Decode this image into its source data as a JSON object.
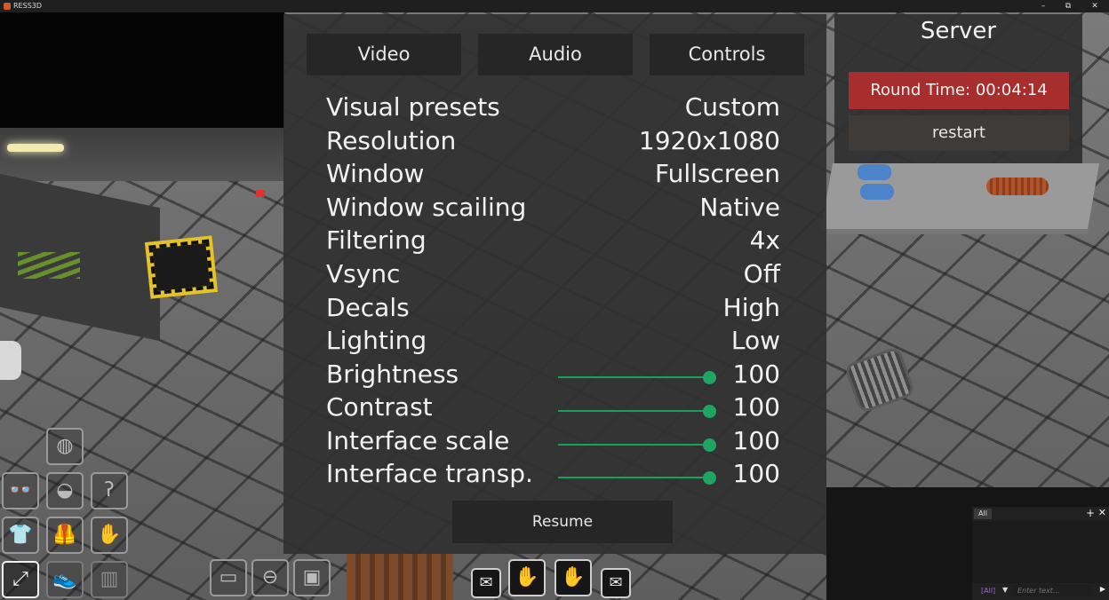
{
  "window": {
    "title": "RESS3D",
    "minimize": "–",
    "restore": "⧉",
    "close": "✕"
  },
  "settings": {
    "tabs": [
      {
        "label": "Video"
      },
      {
        "label": "Audio"
      },
      {
        "label": "Controls"
      }
    ],
    "rows": [
      {
        "label": "Visual presets",
        "value": "Custom"
      },
      {
        "label": "Resolution",
        "value": "1920x1080"
      },
      {
        "label": "Window",
        "value": "Fullscreen"
      },
      {
        "label": "Window scailing",
        "value": "Native"
      },
      {
        "label": "Filtering",
        "value": "4x"
      },
      {
        "label": "Vsync",
        "value": "Off"
      },
      {
        "label": "Decals",
        "value": "High"
      },
      {
        "label": "Lighting",
        "value": "Low"
      }
    ],
    "sliders": [
      {
        "label": "Brightness",
        "value": "100",
        "level": 1.0
      },
      {
        "label": "Contrast",
        "value": "100",
        "level": 1.0
      },
      {
        "label": "Interface scale",
        "value": "100",
        "level": 1.0
      },
      {
        "label": "Interface transp.",
        "value": "100",
        "level": 1.0
      }
    ],
    "resume_label": "Resume",
    "slider_color": "#1ea55f"
  },
  "server": {
    "title": "Server",
    "round_time": "Round Time: 00:04:14",
    "restart_label": "restart",
    "round_time_color": "#a82e2e"
  },
  "inventory": {
    "slots": [
      {
        "name": "helmet-slot",
        "icon": "helmet-icon",
        "glyph": "◍"
      },
      {
        "name": "glasses-slot",
        "icon": "glasses-icon",
        "glyph": "👓"
      },
      {
        "name": "mask-slot",
        "icon": "mask-icon",
        "glyph": "◒"
      },
      {
        "name": "ear-slot",
        "icon": "ear-icon",
        "glyph": "ʔ"
      },
      {
        "name": "uniform-slot",
        "icon": "shirt-icon",
        "glyph": "👕"
      },
      {
        "name": "vest-slot",
        "icon": "vest-icon",
        "glyph": "🦺"
      },
      {
        "name": "gloves-slot",
        "icon": "glove-icon",
        "glyph": "✋"
      },
      {
        "name": "toggle-inventory-slot",
        "icon": "expand-icon",
        "glyph": "⤢"
      },
      {
        "name": "shoes-slot",
        "icon": "shoes-icon",
        "glyph": "👟"
      },
      {
        "name": "suit-slot",
        "icon": "suit-icon",
        "glyph": "▥"
      },
      {
        "name": "id-card-slot",
        "icon": "id-card-icon",
        "glyph": "▭"
      },
      {
        "name": "belt-slot",
        "icon": "belt-icon",
        "glyph": "⊖"
      },
      {
        "name": "backpack-slot",
        "icon": "backpack-icon",
        "glyph": "▣"
      },
      {
        "name": "left-pocket-slot",
        "icon": "pocket-icon",
        "glyph": "✉"
      },
      {
        "name": "right-hand-slot",
        "icon": "hand-icon",
        "glyph": "✋"
      },
      {
        "name": "left-hand-slot",
        "icon": "hand-icon",
        "glyph": "✋"
      },
      {
        "name": "right-pocket-slot",
        "icon": "pocket-icon",
        "glyph": "✉"
      }
    ]
  },
  "chat": {
    "tab_label": "All",
    "add": "+",
    "close": "✕",
    "channel": "[All]",
    "dropdown": "▼",
    "placeholder": "Enter text...",
    "send": "▶"
  }
}
